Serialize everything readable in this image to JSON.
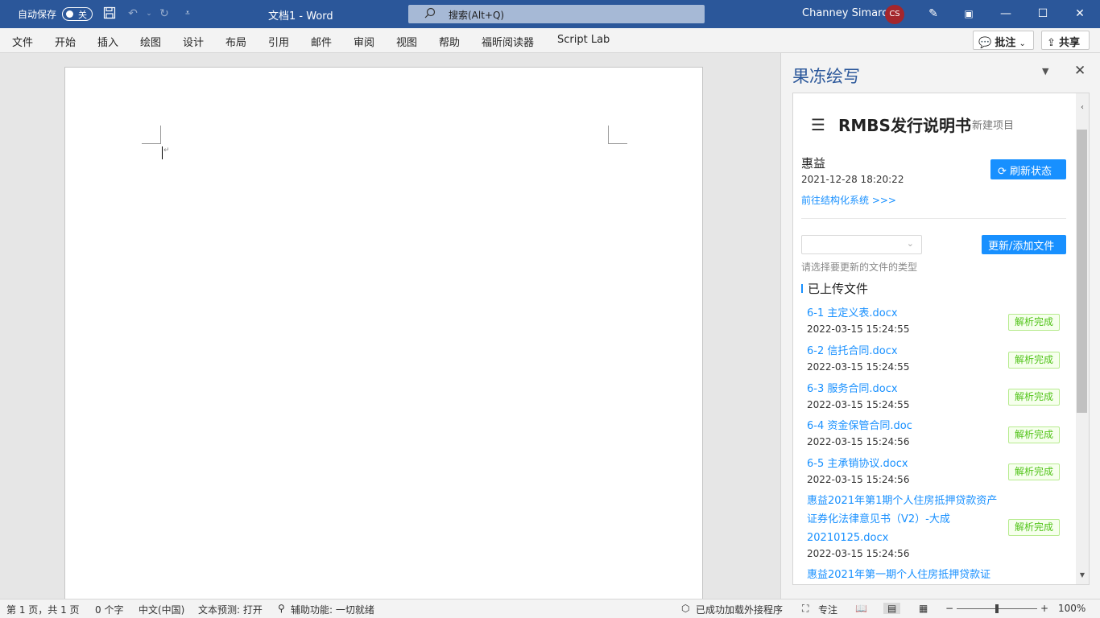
{
  "titlebar": {
    "autosave_label": "自动保存",
    "autosave_state": "关",
    "doc_title": "文档1  -  Word",
    "search_placeholder": "搜索(Alt+Q)",
    "user_name": "Channey Simarc",
    "user_initials": "CS"
  },
  "ribbon": {
    "tabs": [
      "文件",
      "开始",
      "插入",
      "绘图",
      "设计",
      "布局",
      "引用",
      "邮件",
      "审阅",
      "视图",
      "帮助",
      "福昕阅读器",
      "Script Lab"
    ],
    "comments_label": "批注",
    "share_label": "共享"
  },
  "pane": {
    "title": "果冻绘写",
    "project_title": "RMBS发行说明书",
    "new_project": "新建项目",
    "org_name": "惠益",
    "datetime": "2021-12-28 18:20:22",
    "goto_link": "前往结构化系统 >>>",
    "refresh_label": "刷新状态",
    "update_label": "更新/添加文件",
    "select_value": "",
    "select_hint": "请选择要更新的文件的类型",
    "uploaded_heading": "已上传文件",
    "files": [
      {
        "name": "6-1 主定义表.docx",
        "date": "2022-03-15 15:24:55",
        "status": "解析完成"
      },
      {
        "name": "6-2 信托合同.docx",
        "date": "2022-03-15 15:24:55",
        "status": "解析完成"
      },
      {
        "name": "6-3 服务合同.docx",
        "date": "2022-03-15 15:24:55",
        "status": "解析完成"
      },
      {
        "name": "6-4 资金保管合同.doc",
        "date": "2022-03-15 15:24:56",
        "status": "解析完成"
      },
      {
        "name": "6-5 主承销协议.docx",
        "date": "2022-03-15 15:24:56",
        "status": "解析完成"
      },
      {
        "name_lines": [
          "惠益2021年第1期个人住房抵押贷款资产",
          "证券化法律意见书（V2）-大成",
          "20210125.docx"
        ],
        "date": "2022-03-15 15:24:56",
        "status": "解析完成"
      },
      {
        "name": "惠益2021年第一期个人住房抵押贷款证"
      }
    ]
  },
  "statusbar": {
    "page": "第 1 页，共 1 页",
    "words": "0 个字",
    "language": "中文(中国)",
    "predict": "文本预测: 打开",
    "accessibility": "辅助功能: 一切就绪",
    "addins": "已成功加载外接程序",
    "focus": "专注",
    "zoom": "100%"
  }
}
